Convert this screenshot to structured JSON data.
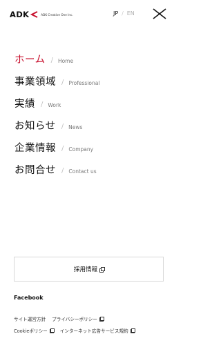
{
  "header": {
    "logo_text": "ADK",
    "logo_sub": "ADK Creative One Inc.",
    "lang_jp": "JP",
    "lang_sep": "/",
    "lang_en": "EN"
  },
  "nav": {
    "slash": "/",
    "items": [
      {
        "jp": "ホーム",
        "en": "Home",
        "active": true
      },
      {
        "jp": "事業領域",
        "en": "Professional",
        "active": false
      },
      {
        "jp": "実績",
        "en": "Work",
        "active": false
      },
      {
        "jp": "お知らせ",
        "en": "News",
        "active": false
      },
      {
        "jp": "企業情報",
        "en": "Company",
        "active": false
      },
      {
        "jp": "お問合せ",
        "en": "Contact us",
        "active": false
      }
    ]
  },
  "recruit": {
    "label": "採用情報"
  },
  "facebook": {
    "label": "Facebook"
  },
  "footer_links": {
    "site_policy": "サイト運営方針",
    "privacy": "プライバシーポリシー",
    "cookie": "Cookieポリシー",
    "ad_terms": "インターネット広告サービス規約"
  },
  "colors": {
    "accent": "#c8102e",
    "text": "#111111",
    "muted": "#777777",
    "border": "#d7d7d7"
  },
  "icons": {
    "close": "close-icon",
    "external": "external-link-icon"
  }
}
